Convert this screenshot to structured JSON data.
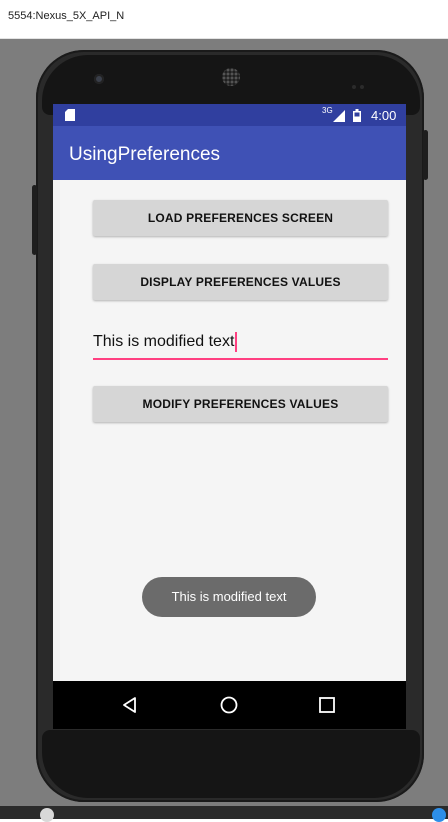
{
  "window": {
    "title": "5554:Nexus_5X_API_N"
  },
  "status_bar": {
    "network": "3G",
    "time": "4:00",
    "icons": [
      "sd-card-icon",
      "signal-icon",
      "battery-icon"
    ]
  },
  "app_bar": {
    "title": "UsingPreferences"
  },
  "main": {
    "buttons": {
      "load": "LOAD PREFERENCES SCREEN",
      "display": "DISPLAY PREFERENCES VALUES",
      "modify": "MODIFY PREFERENCES VALUES"
    },
    "text_input": {
      "value": "This is modified text"
    }
  },
  "toast": {
    "message": "This is modified text"
  },
  "nav_bar": {
    "icons": [
      "back-icon",
      "home-icon",
      "recents-icon"
    ]
  },
  "colors": {
    "status_bar": "#303f9f",
    "app_bar": "#3f51b5",
    "accent": "#ff4081",
    "screen_bg": "#f5f5f5",
    "button_bg": "#d6d6d6",
    "toast_bg": "#6b6b6b"
  }
}
